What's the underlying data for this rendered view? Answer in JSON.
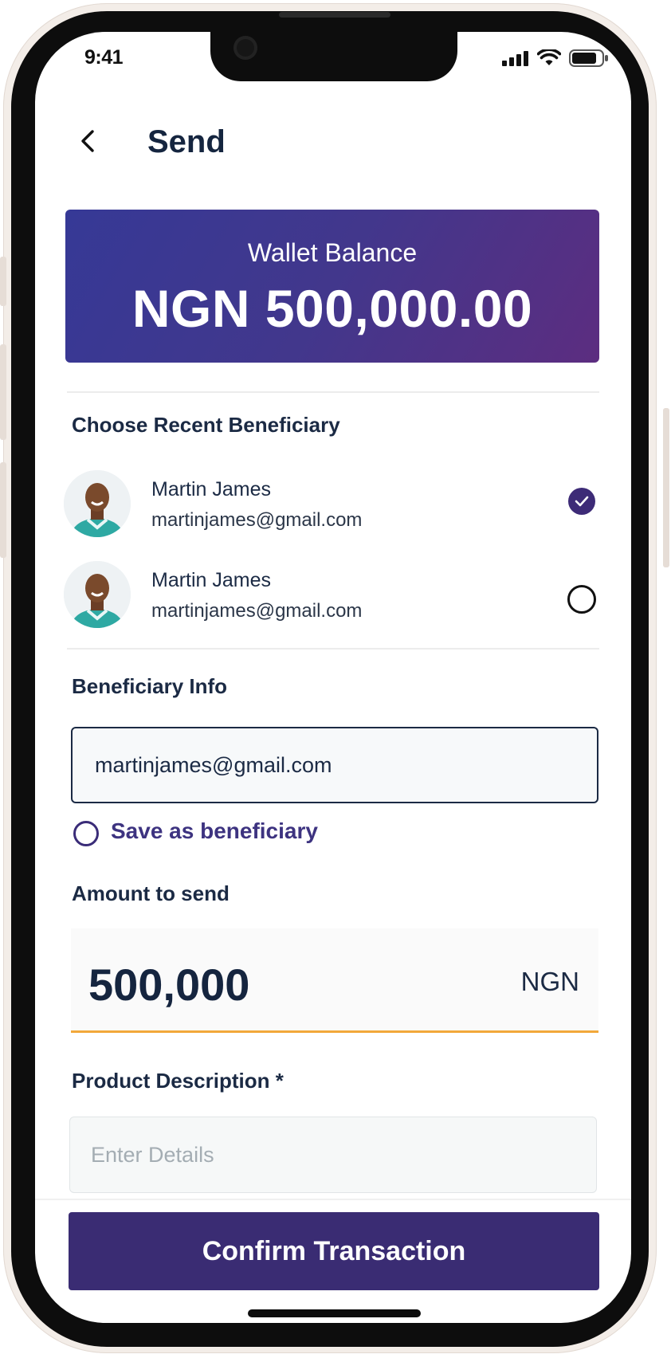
{
  "status_bar": {
    "time": "9:41"
  },
  "header": {
    "title": "Send",
    "back_icon": "chevron-left-icon"
  },
  "wallet": {
    "label": "Wallet Balance",
    "amount": "NGN 500,000.00",
    "gradient_start": "#363996",
    "gradient_end": "#5c2d80"
  },
  "recent": {
    "heading": "Choose Recent Beneficiary",
    "items": [
      {
        "name": "Martin James",
        "email": "martinjames@gmail.com",
        "selected": true
      },
      {
        "name": "Martin James",
        "email": "martinjames@gmail.com",
        "selected": false
      }
    ]
  },
  "beneficiary_info": {
    "heading": "Beneficiary Info",
    "email_value": "martinjames@gmail.com",
    "save_label": "Save as beneficiary"
  },
  "amount": {
    "heading": "Amount to send",
    "value": "500,000",
    "currency": "NGN"
  },
  "description": {
    "heading": "Product Description *",
    "placeholder": "Enter Details"
  },
  "confirm": {
    "label": "Confirm Transaction",
    "color": "#3a2c73"
  },
  "colors": {
    "accent_underline": "#f2a83a",
    "text_dark": "#15253f"
  }
}
